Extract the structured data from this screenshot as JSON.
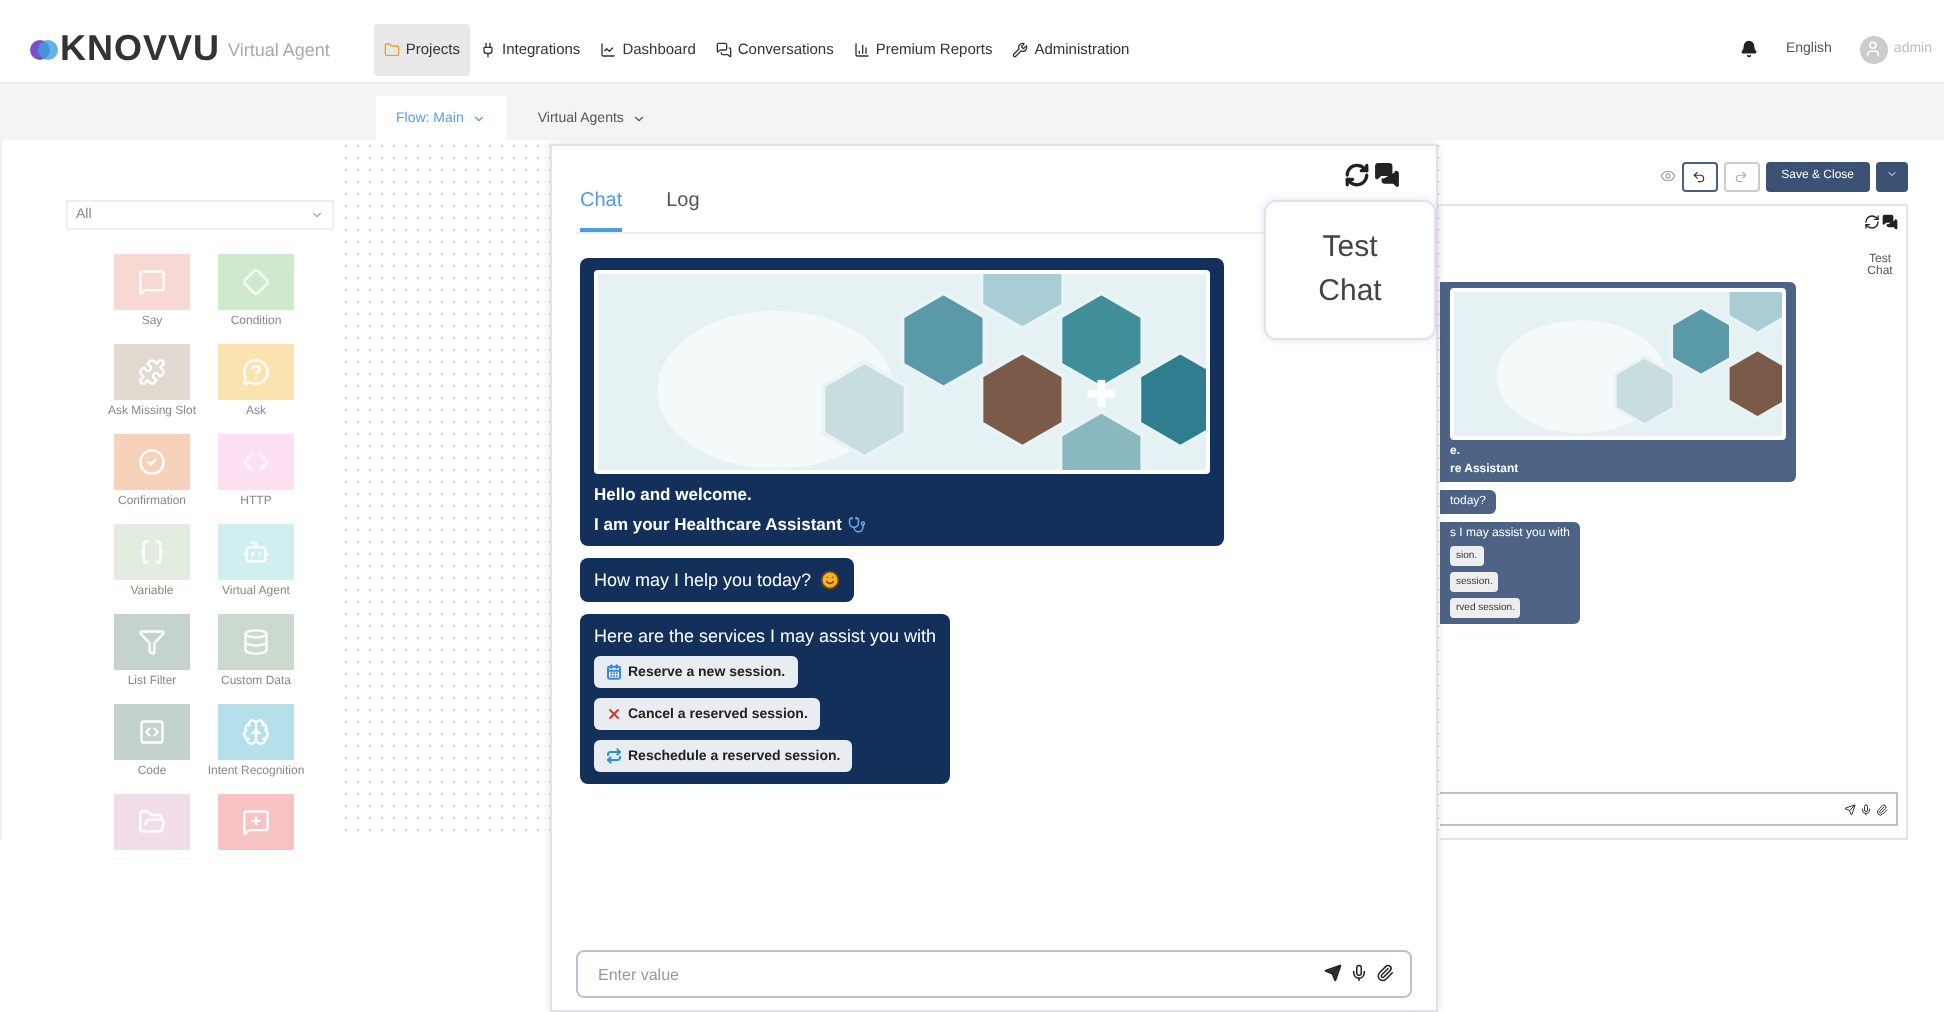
{
  "header": {
    "logo": "KNOVVU",
    "product": "Virtual Agent",
    "language": "English",
    "user": "admin",
    "nav": [
      {
        "label": "Projects",
        "selected": true
      },
      {
        "label": "Integrations",
        "selected": false
      },
      {
        "label": "Dashboard",
        "selected": false
      },
      {
        "label": "Conversations",
        "selected": false
      },
      {
        "label": "Premium Reports",
        "selected": false
      },
      {
        "label": "Administration",
        "selected": false
      }
    ]
  },
  "flow_tabs": [
    {
      "label": "Flow: Main",
      "selected": true
    },
    {
      "label": "Virtual Agents",
      "selected": false
    }
  ],
  "palette": {
    "filter": "All",
    "items": [
      {
        "label": "Say",
        "color": "#f8d8d2"
      },
      {
        "label": "Condition",
        "color": "#cfe9cc"
      },
      {
        "label": "Ask Missing Slot",
        "color": "#e2d9d0"
      },
      {
        "label": "Ask",
        "color": "#fbe3b0"
      },
      {
        "label": "Confirmation",
        "color": "#f6d3b8"
      },
      {
        "label": "HTTP",
        "color": "#fde0f1"
      },
      {
        "label": "Variable",
        "color": "#e2ede0"
      },
      {
        "label": "Virtual Agent",
        "color": "#cfeff1"
      },
      {
        "label": "List Filter",
        "color": "#c5d3cd"
      },
      {
        "label": "Custom Data",
        "color": "#cbdacd"
      },
      {
        "label": "Code",
        "color": "#c3d2cb"
      },
      {
        "label": "Intent Recognition",
        "color": "#b5dfeb"
      },
      {
        "color": "#f0dde9"
      },
      {
        "color": "#f6c2c2"
      }
    ]
  },
  "toolbar": {
    "save": "Save & Close"
  },
  "background_chat": {
    "tooltip": "Test Chat",
    "welcome_lines": [
      "e.",
      "re Assistant"
    ],
    "greeting": "today?",
    "services_title": "s I may assist you with",
    "options": [
      "sion.",
      "session.",
      "rved session."
    ]
  },
  "chat": {
    "tabs": [
      {
        "label": "Chat",
        "selected": true
      },
      {
        "label": "Log",
        "selected": false
      }
    ],
    "tooltip": "Test Chat",
    "messages": [
      {
        "kind": "card",
        "lines": [
          "Hello and welcome.",
          "I am your Healthcare Assistant"
        ]
      },
      {
        "kind": "text",
        "text": "How may I help you today?"
      },
      {
        "kind": "options",
        "text": "Here are the services I may assist you with",
        "options": [
          "Reserve a new session.",
          "Cancel a reserved session.",
          "Reschedule a reserved session."
        ]
      }
    ],
    "input": {
      "placeholder": "Enter value"
    }
  }
}
